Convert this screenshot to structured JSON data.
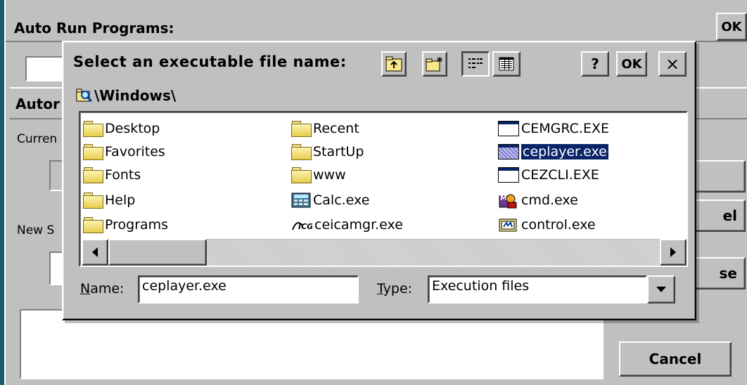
{
  "background_window": {
    "title": "Auto Run Programs:",
    "ok_label": "OK"
  },
  "inner_window": {
    "title_partial": "Autor",
    "current_label_partial": "Curren",
    "new_label_partial": "New S",
    "button2_partial": "el",
    "button3_partial": "se",
    "cancel_label": "Cancel"
  },
  "dialog": {
    "title": "Select an executable file name:",
    "help_label": "?",
    "ok_label": "OK",
    "close_label": "×",
    "path": "\\Windows\\",
    "files": [
      {
        "name": "Desktop",
        "icon": "folder-icon"
      },
      {
        "name": "Favorites",
        "icon": "folder-icon"
      },
      {
        "name": "Fonts",
        "icon": "folder-icon"
      },
      {
        "name": "Help",
        "icon": "folder-icon"
      },
      {
        "name": "Programs",
        "icon": "folder-icon"
      },
      {
        "name": "Recent",
        "icon": "folder-icon"
      },
      {
        "name": "StartUp",
        "icon": "folder-icon"
      },
      {
        "name": "www",
        "icon": "folder-icon"
      },
      {
        "name": "Calc.exe",
        "icon": "calculator-icon"
      },
      {
        "name": "ceicamgr.exe",
        "icon": "ceicamgr-icon"
      },
      {
        "name": "CEMGRC.EXE",
        "icon": "window-exe-icon"
      },
      {
        "name": "ceplayer.exe",
        "icon": "window-exe-icon",
        "selected": true
      },
      {
        "name": "CEZCLI.EXE",
        "icon": "window-exe-icon"
      },
      {
        "name": "cmd.exe",
        "icon": "cmd-icon"
      },
      {
        "name": "control.exe",
        "icon": "control-panel-icon"
      }
    ],
    "name_label_prefix": "N",
    "name_label_rest": "ame:",
    "name_value": "ceplayer.exe",
    "type_label_prefix": "T",
    "type_label_rest": "ype:",
    "type_value": "Execution files"
  },
  "colors": {
    "face": "#c0c0c0",
    "selection": "#0a246a",
    "desktop_edge": "#1a5a6e"
  }
}
